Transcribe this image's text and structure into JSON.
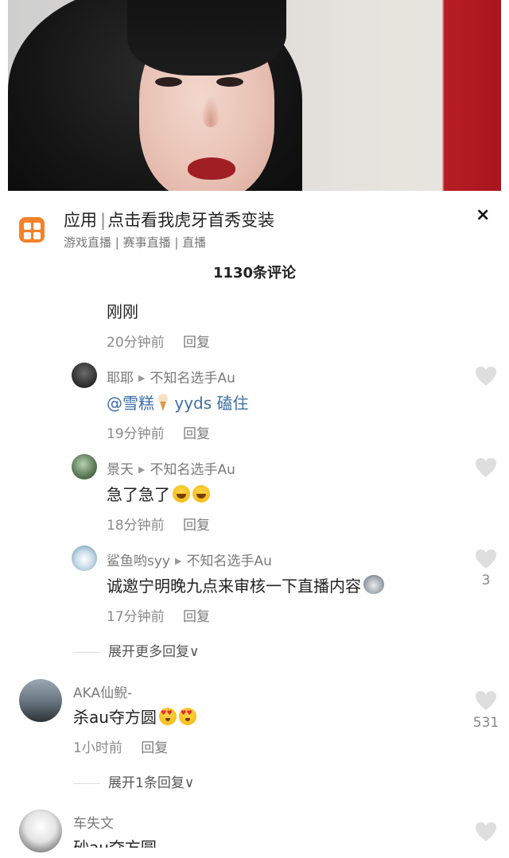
{
  "ad": {
    "category": "应用",
    "separator": "|",
    "title": "点击看我虎牙首秀变装",
    "subtitle": "游戏直播 | 赛事直播 | 直播",
    "close_label": "×",
    "icon": "app-grid-icon",
    "brand_color": "#f5822a"
  },
  "comments_count": "1130条评论",
  "comments": [
    {
      "text": "刚刚",
      "time": "20分钟前",
      "reply_label": "回复"
    },
    {
      "user": "耶耶",
      "reply_to": "不知名选手Au",
      "mention": "@雪糕",
      "text": "yyds 磕住",
      "time": "19分钟前",
      "reply_label": "回复"
    },
    {
      "user": "景天",
      "reply_to": "不知名选手Au",
      "text": "急了急了",
      "time": "18分钟前",
      "reply_label": "回复"
    },
    {
      "user": "鲨鱼哟syy",
      "reply_to": "不知名选手Au",
      "text": "诚邀宁明晚九点来审核一下直播内容",
      "time": "17分钟前",
      "reply_label": "回复",
      "likes": "3"
    },
    {
      "user": "AKA仙鲵-",
      "text": "杀au夺方圆",
      "time": "1小时前",
      "reply_label": "回复",
      "likes": "531"
    },
    {
      "user": "车失文",
      "text": "砂au夺方圆"
    }
  ],
  "expand_more": "展开更多回复",
  "expand_one": "展开1条回复",
  "chevron": "∨",
  "colors": {
    "mention": "#3e6fa8",
    "meta": "#8a8a8a"
  }
}
